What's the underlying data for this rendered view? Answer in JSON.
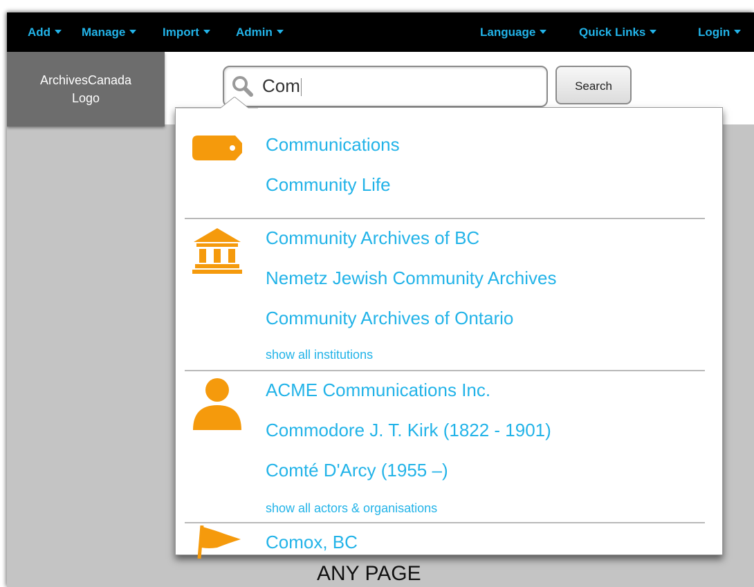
{
  "nav": {
    "left": [
      {
        "label": "Add"
      },
      {
        "label": "Manage"
      },
      {
        "label": "Import"
      },
      {
        "label": "Admin"
      }
    ],
    "right": [
      {
        "label": "Language"
      },
      {
        "label": "Quick Links"
      },
      {
        "label": "Login"
      }
    ]
  },
  "logo": {
    "line1": "ArchivesCanada",
    "line2": "Logo"
  },
  "search": {
    "query": "Com",
    "button_label": "Search"
  },
  "dropdown": {
    "subjects": [
      {
        "label": "Communications"
      },
      {
        "label": "Community Life"
      }
    ],
    "institutions": [
      {
        "label": "Community Archives of BC"
      },
      {
        "label": "Nemetz Jewish Community Archives"
      },
      {
        "label": "Community Archives of Ontario"
      }
    ],
    "institutions_more": "show all institutions",
    "actors": [
      {
        "label": "ACME Communications Inc."
      },
      {
        "label": "Commodore J. T. Kirk (1822 - 1901)"
      },
      {
        "label": "Comté D'Arcy (1955 –)"
      }
    ],
    "actors_more": "show all actors & organisations",
    "places": [
      {
        "label": "Comox, BC"
      }
    ]
  },
  "page_caption": "ANY PAGE",
  "colors": {
    "nav_bg": "#000000",
    "link": "#22b3e8",
    "icon_accent": "#f59a0c",
    "logo_bg": "#6d6d6d",
    "page_bg": "#c4c4c4"
  },
  "icons": {
    "subjects": "tag-icon",
    "institutions": "institution-building-icon",
    "actors": "person-icon",
    "places": "flag-icon",
    "search": "magnifier-icon"
  }
}
